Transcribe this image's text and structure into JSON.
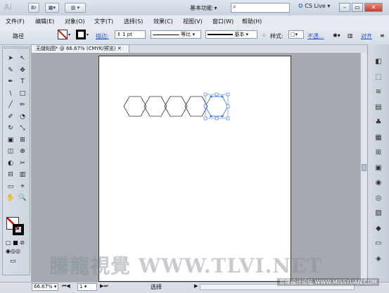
{
  "app": {
    "logo": "Ai"
  },
  "titlebar": {
    "bridge_label": "Br",
    "workspace": "基本功能",
    "search_placeholder": "",
    "cs_live": "CS Live"
  },
  "menus": [
    "文件(F)",
    "编辑(E)",
    "对象(O)",
    "文字(T)",
    "选择(S)",
    "效果(C)",
    "视图(V)",
    "窗口(W)",
    "帮助(H)"
  ],
  "control": {
    "selection_label": "路径",
    "stroke_label": "描边:",
    "stroke_weight": "1 pt",
    "profile_label": "等比",
    "brush_label": "基本",
    "style_label": "样式:",
    "opacity_label": "不透...",
    "align_label": "对齐"
  },
  "document": {
    "tab_title": "无缝贴图* @ 66.67% (CMYK/预览)"
  },
  "status": {
    "zoom": "66.67%",
    "page": "1",
    "tool": "选择"
  },
  "watermark": "騰龍視覺 WWW.TLVI.NET",
  "site_watermark": "思缘设计论坛 WWW.MISSYUAN.COM",
  "tools_left": [
    "➤",
    "↖",
    "✎",
    "✥",
    "✒",
    "T",
    "\\",
    "□",
    "╱",
    "✏",
    "✐",
    "◔",
    "↻",
    "⤡",
    "▣",
    "⊞",
    "◫",
    "⊕",
    "◐",
    "✂",
    "⊟",
    "▥",
    "▭",
    "⌖",
    "✋",
    "🔍"
  ],
  "dock_right": [
    "◧",
    "⬚",
    "≋",
    "▤",
    "♣",
    "▦",
    "⊞",
    "▣",
    "◉",
    "◎",
    "▨",
    "◆",
    "▭",
    "◈"
  ]
}
